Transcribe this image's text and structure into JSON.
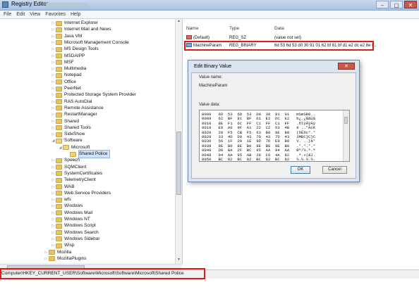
{
  "window": {
    "title": "Registry Editor",
    "buttons": [
      "–",
      "▢",
      "✕"
    ]
  },
  "menu": [
    "File",
    "Edit",
    "View",
    "Favorites",
    "Help"
  ],
  "tree": {
    "items": [
      {
        "label": "Internet Explorer",
        "state": "collapsed"
      },
      {
        "label": "Internet Mail and News",
        "state": "collapsed"
      },
      {
        "label": "Java VM",
        "state": "collapsed"
      },
      {
        "label": "Microsoft Management Console",
        "state": "collapsed"
      },
      {
        "label": "MS Design Tools",
        "state": "collapsed"
      },
      {
        "label": "MSDAIPP",
        "state": "collapsed"
      },
      {
        "label": "MSF",
        "state": "collapsed"
      },
      {
        "label": "Multimedia",
        "state": "collapsed"
      },
      {
        "label": "Notepad",
        "state": "collapsed"
      },
      {
        "label": "Office",
        "state": "collapsed"
      },
      {
        "label": "PeerNet",
        "state": "collapsed"
      },
      {
        "label": "Protected Storage System Provider",
        "state": "collapsed"
      },
      {
        "label": "RAS AutoDial",
        "state": "collapsed"
      },
      {
        "label": "Remote Assistance",
        "state": "collapsed"
      },
      {
        "label": "RestartManager",
        "state": "collapsed"
      },
      {
        "label": "Shared",
        "state": "collapsed"
      },
      {
        "label": "Shared Tools",
        "state": "collapsed"
      },
      {
        "label": "SideShow",
        "state": "collapsed"
      },
      {
        "label": "Software",
        "state": "expanded"
      },
      {
        "label": "Microsoft",
        "state": "expanded",
        "level": 1
      },
      {
        "label": "Shared Police",
        "state": "selected",
        "level": 2
      },
      {
        "label": "Speech",
        "state": "collapsed"
      },
      {
        "label": "SQMClient",
        "state": "collapsed"
      },
      {
        "label": "SystemCertificates",
        "state": "collapsed"
      },
      {
        "label": "TelemetryClient",
        "state": "collapsed"
      },
      {
        "label": "WAB",
        "state": "collapsed"
      },
      {
        "label": "Web Service Providers",
        "state": "collapsed"
      },
      {
        "label": "wfs",
        "state": "collapsed"
      },
      {
        "label": "Windows",
        "state": "collapsed"
      },
      {
        "label": "Windows Mail",
        "state": "collapsed"
      },
      {
        "label": "Windows NT",
        "state": "collapsed"
      },
      {
        "label": "Windows Script",
        "state": "collapsed"
      },
      {
        "label": "Windows Search",
        "state": "collapsed"
      },
      {
        "label": "Windows Sidebar",
        "state": "collapsed"
      },
      {
        "label": "Wisp",
        "state": "collapsed"
      },
      {
        "label": "Mozilla",
        "state": "collapsed",
        "level": -1
      },
      {
        "label": "MozillaPlugins",
        "state": "collapsed",
        "level": -1
      }
    ]
  },
  "list": {
    "headers": [
      "Name",
      "Type",
      "Data"
    ],
    "rows": [
      {
        "name": "(Default)",
        "type": "REG_SZ",
        "data": "(value not set)"
      },
      {
        "name": "MachineParam",
        "type": "REG_BINARY",
        "data": "6d 53 6d 53 d0 30 91 01 62 bf 81 bf d1 e2 dc e2 8e f..."
      }
    ]
  },
  "dialog": {
    "title": "Edit Binary Value",
    "close": "✕",
    "value_name_label": "Value name:",
    "value_name": "MachineParam",
    "value_data_label": "Value data:",
    "hex_rows": [
      "0000   6D  53  6D  53  D0  30  91  01   mSmSÐ0..",
      "0008   62  BF  81  BF  D1  E2  DC  E2   b¿.¿ÑâÜâ",
      "0010   8E  F1  6C  FF  C1  FF  C1  FF   .ñlÿÁÿÁÿ",
      "0018   E9  A0  9F  A1  22  C2  63  4B   é ..\"ÂcK",
      "0020   28  F5  CB  F5  63  B0  8E  B0   (õËõc°.°",
      "0028   33  4D  D0  43  7D  43  7D  43   3MÐC}C}C",
      "0030   56  1F  20  1E  9D  7D  E0  B0   V. ..}à°",
      "0038   8E  B0  8E  B0  8E  B0  8E  B0   .°.°.°.°",
      "0040   D8  BA  2F  BC  95  AA  94  AA   Øº/¼.ª.ª",
      "0048   94  AA  95  AB  28  C6  4A  82   .ª.«(ÆJ.",
      "0050   BC  82  BC  82  BC  82  BC  82   ¼.¼.¼.¼."
    ],
    "ok": "OK",
    "cancel": "Cancel"
  },
  "status": {
    "path": "Computer\\HKEY_CURRENT_USER\\Software\\Microsoft\\Software\\Microsoft\\Shared Police"
  },
  "colors": {
    "highlight": "#e01a1a",
    "selection": "#cfe3fb"
  }
}
